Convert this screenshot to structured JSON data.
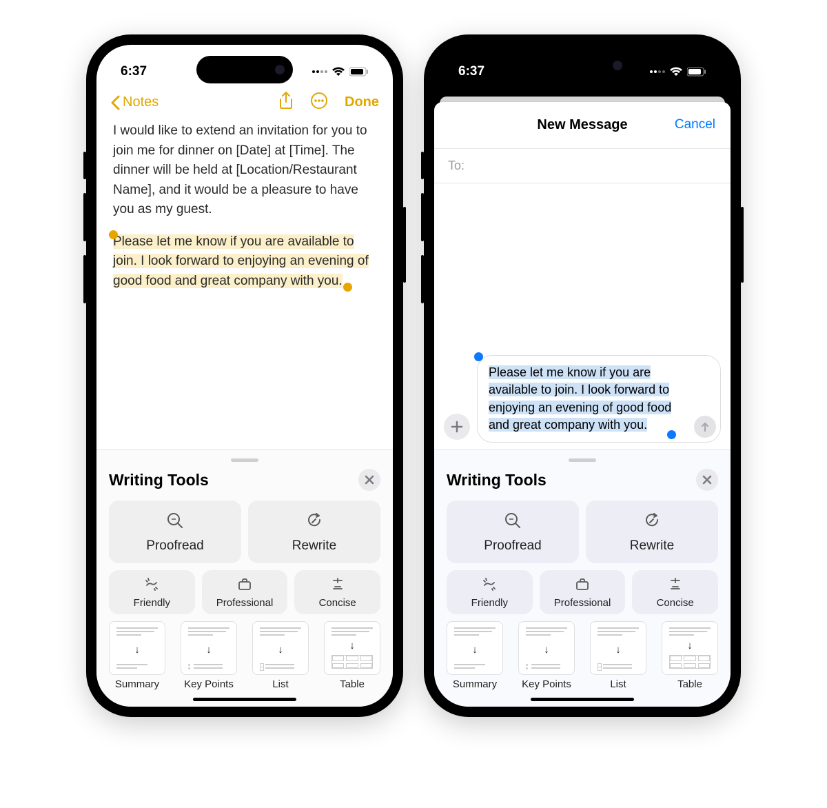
{
  "status": {
    "time": "6:37"
  },
  "notes": {
    "back_label": "Notes",
    "done_label": "Done",
    "para1": "I would like to extend an invitation for you to join me for dinner on [Date] at [Time]. The dinner will be held at [Location/Restaurant Name], and it would be a pleasure to have you as my guest.",
    "selected": "Please let me know if you are available to join. I look forward to enjoying an evening of good food and great company with you."
  },
  "messages": {
    "title": "New Message",
    "cancel": "Cancel",
    "to_label": "To:",
    "compose_text": "Please let me know if you are available to join. I look forward to enjoying an evening of good food and great company with you."
  },
  "wt": {
    "title": "Writing Tools",
    "proofread": "Proofread",
    "rewrite": "Rewrite",
    "friendly": "Friendly",
    "professional": "Professional",
    "concise": "Concise",
    "summary": "Summary",
    "keypoints": "Key Points",
    "list": "List",
    "table": "Table"
  }
}
